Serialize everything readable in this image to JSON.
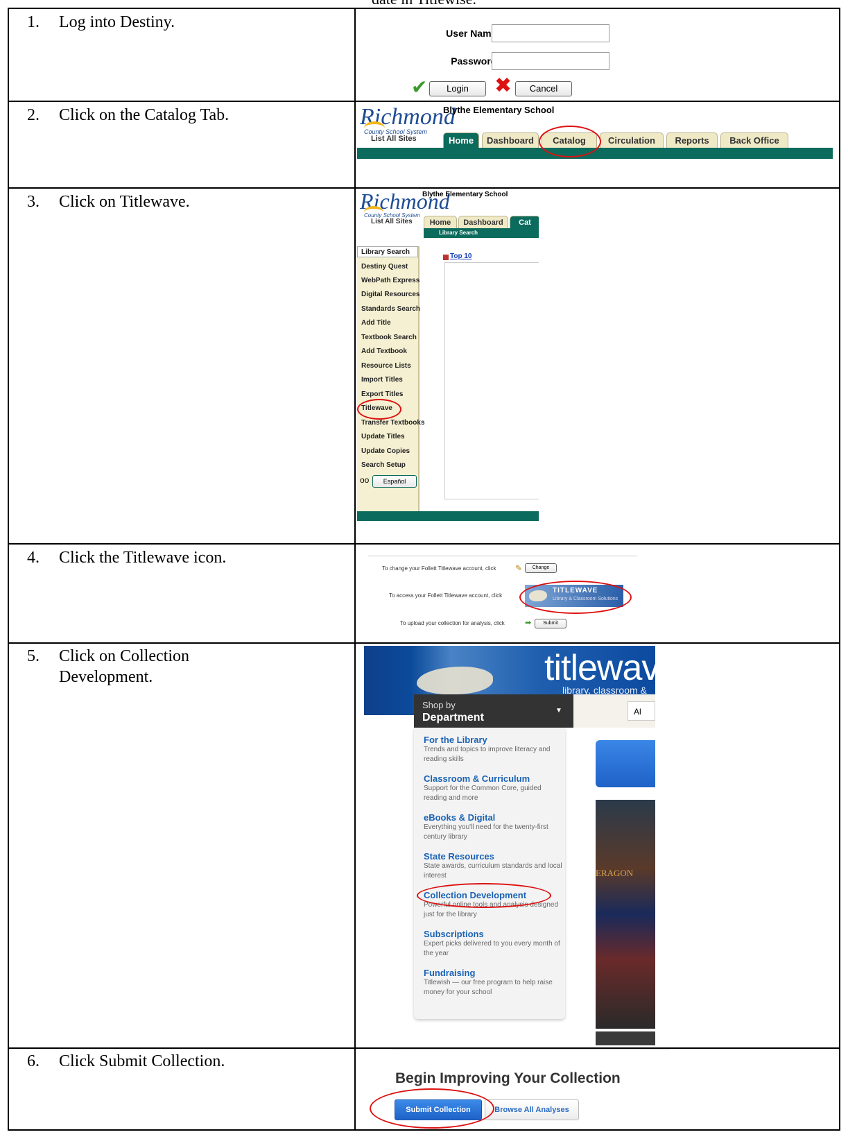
{
  "caption": "date in Titlewise.",
  "steps": [
    {
      "num": "1.",
      "text": "Log into Destiny."
    },
    {
      "num": "2.",
      "text": "Click on the Catalog Tab."
    },
    {
      "num": "3.",
      "text": "Click on Titlewave."
    },
    {
      "num": "4.",
      "text": "Click the Titlewave icon."
    },
    {
      "num": "5.",
      "text": "Click on Collection Development."
    },
    {
      "num": "6.",
      "text": "Click Submit Collection."
    }
  ],
  "login": {
    "username_label": "User Name:",
    "password_label": "Password:",
    "login_button": "Login",
    "cancel_button": "Cancel"
  },
  "destiny": {
    "logo_text": "Richmond",
    "logo_sub": "County School System",
    "list_all_sites": "List All Sites",
    "school": "Blythe Elementary School",
    "tabs": [
      "Home",
      "Dashboard",
      "Catalog",
      "Circulation",
      "Reports",
      "Back Office"
    ],
    "short_tabs": [
      "Home",
      "Dashboard",
      "Cat"
    ],
    "subheader": "Library Search",
    "top10": "Top 10",
    "espanol": "Español",
    "menu": [
      "Library Search",
      "Destiny Quest",
      "WebPath Express",
      "Digital Resources",
      "Standards Search",
      "Add Title",
      "Textbook Search",
      "Add Textbook",
      "Resource Lists",
      "Import Titles",
      "Export Titles",
      "Titlewave",
      "Transfer Textbooks",
      "Update Titles",
      "Update Copies",
      "Search Setup"
    ]
  },
  "follett": {
    "change_line": "To change your Follett Titlewave account, click",
    "change_btn": "Change",
    "access_line": "To access your Follett Titlewave account, click",
    "banner_title": "TITLEWAVE",
    "banner_sub": "Library & Classroom Solutions",
    "upload_line": "To upload your collection for analysis, click",
    "submit_btn": "Submit"
  },
  "titlewave": {
    "brand": "titlewave.c",
    "tagline": "library, classroom & digital",
    "shop_by": "Shop by",
    "department": "Department",
    "search_stub": "Al",
    "book_label": "ERAGON",
    "departments": [
      {
        "title": "For the Library",
        "desc": "Trends and topics to improve literacy and reading skills"
      },
      {
        "title": "Classroom & Curriculum",
        "desc": "Support for the Common Core, guided reading and more"
      },
      {
        "title": "eBooks & Digital",
        "desc": "Everything you'll need for the twenty-first century library"
      },
      {
        "title": "State Resources",
        "desc": "State awards, curriculum standards and local interest"
      },
      {
        "title": "Collection Development",
        "desc": "Powerful online tools and analysis designed just for the library"
      },
      {
        "title": "Subscriptions",
        "desc": "Expert picks delivered to you every month of the year"
      },
      {
        "title": "Fundraising",
        "desc": "Titlewish — our free program to help raise money for your school"
      }
    ]
  },
  "collection": {
    "heading": "Begin Improving Your Collection",
    "submit": "Submit Collection",
    "browse": "Browse All Analyses"
  },
  "colors": {
    "accent_red": "#d11",
    "destiny_teal": "#0b6b5c",
    "titlewave_blue": "#1a62b5"
  }
}
